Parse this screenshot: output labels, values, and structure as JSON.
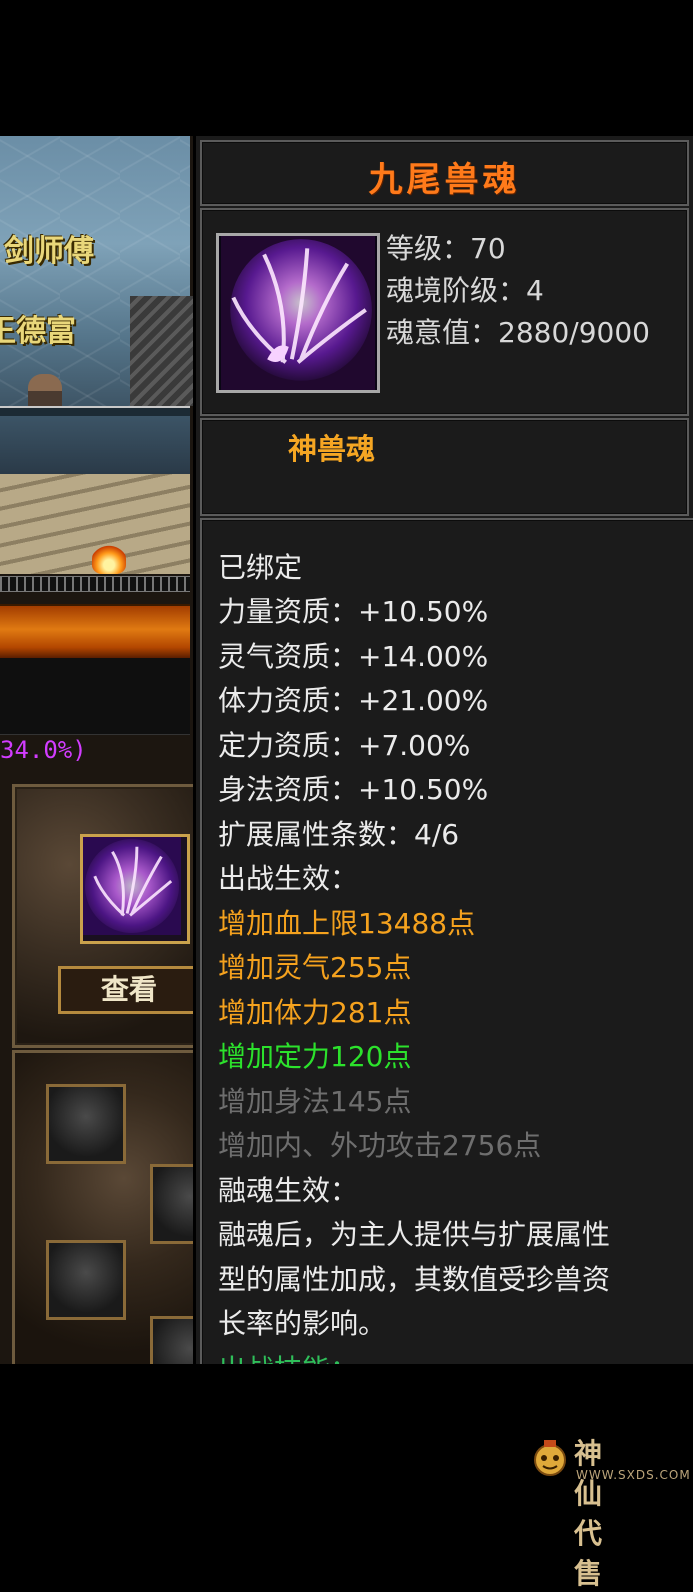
{
  "left_panel": {
    "npc_title": "剑师傅",
    "npc_name": "王德富",
    "percent": "34.0%)",
    "view_button": "查看"
  },
  "tooltip": {
    "title": "九尾兽魂",
    "level": "等级：70",
    "realm_tier": "魂境阶级：4",
    "soul_value": "魂意值：2880/9000",
    "category": "神兽魂",
    "lines": [
      {
        "text": "已绑定",
        "color": "white"
      },
      {
        "text": "力量资质：+10.50%",
        "color": "white"
      },
      {
        "text": "灵气资质：+14.00%",
        "color": "white"
      },
      {
        "text": "体力资质：+21.00%",
        "color": "white"
      },
      {
        "text": "定力资质：+7.00%",
        "color": "white"
      },
      {
        "text": "身法资质：+10.50%",
        "color": "white"
      },
      {
        "text": "扩展属性条数：4/6",
        "color": "white"
      },
      {
        "text": "出战生效：",
        "color": "white"
      },
      {
        "text": "增加血上限13488点",
        "color": "orange"
      },
      {
        "text": "增加灵气255点",
        "color": "orange"
      },
      {
        "text": "增加体力281点",
        "color": "orange"
      },
      {
        "text": "增加定力120点",
        "color": "green"
      },
      {
        "text": "增加身法145点",
        "color": "gray"
      },
      {
        "text": "增加内、外功攻击2756点",
        "color": "gray"
      },
      {
        "text": "融魂生效：",
        "color": "white"
      },
      {
        "text": "融魂后，为主人提供与扩展属性",
        "color": "white"
      },
      {
        "text": "型的属性加成，其数值受珍兽资",
        "color": "white"
      },
      {
        "text": "长率的影响。",
        "color": "white"
      },
      {
        "text": "出战技能：",
        "color": "green2"
      }
    ]
  },
  "colors": {
    "title": "#ff7a1a",
    "category": "#f5a623",
    "orange_line": "#f5a21e",
    "green_line": "#2ce22c",
    "gray_line": "#6e6e6e",
    "percent": "#d23cff"
  },
  "watermark": {
    "text": "神仙代售",
    "url": "WWW.SXDS.COM"
  }
}
